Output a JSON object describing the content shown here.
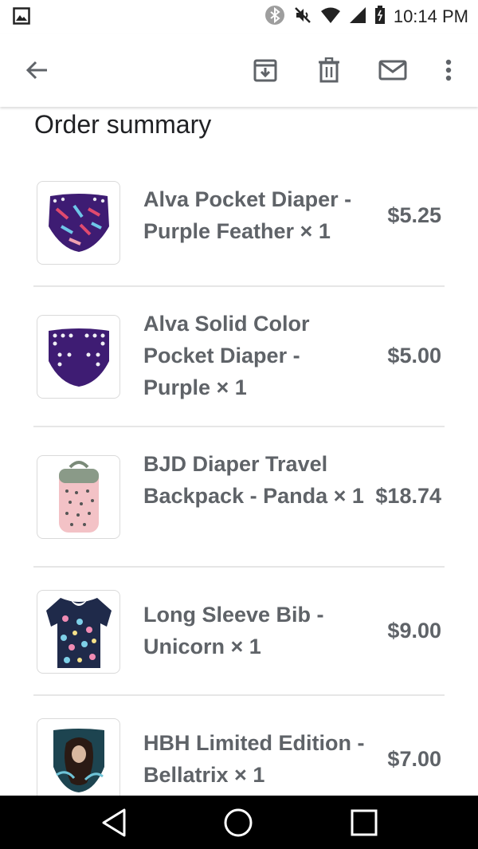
{
  "status_bar": {
    "time": "10:14 PM",
    "icons": [
      "image-notification-icon",
      "bluetooth-icon",
      "mute-icon",
      "wifi-icon",
      "signal-icon",
      "battery-icon"
    ]
  },
  "toolbar": {
    "back": "back-arrow-icon",
    "actions": [
      "archive-icon",
      "delete-icon",
      "mail-icon",
      "more-icon"
    ]
  },
  "order": {
    "title": "Order summary",
    "items": [
      {
        "name": "Alva Pocket Diaper - Purple Feather × 1",
        "price": "$5.25"
      },
      {
        "name": "Alva Solid Color Pocket Diaper - Purple × 1",
        "price": "$5.00"
      },
      {
        "name": "BJD Diaper Travel Backpack - Panda × 1",
        "price": "$18.74"
      },
      {
        "name": "Long Sleeve Bib - Unicorn × 1",
        "price": "$9.00"
      },
      {
        "name": "HBH Limited Edition - Bellatrix × 1",
        "price": "$7.00"
      }
    ]
  },
  "nav_bar": {
    "buttons": [
      "nav-back-icon",
      "nav-home-icon",
      "nav-recents-icon"
    ]
  },
  "colors": {
    "text_secondary": "#5f6368",
    "heading": "#202124",
    "divider": "#e6e6e6",
    "nav_bar": "#000000",
    "diaper_purple": "#3e1c73"
  }
}
